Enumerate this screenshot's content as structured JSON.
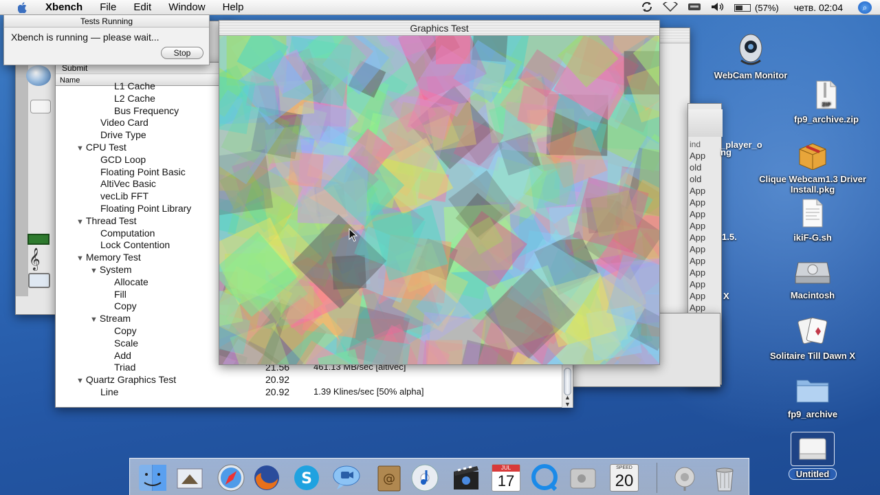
{
  "menubar": {
    "app": "Xbench",
    "items": [
      "File",
      "Edit",
      "Window",
      "Help"
    ],
    "battery": "(57%)",
    "clock": "четв. 02:04"
  },
  "tests_running": {
    "title": "Tests Running",
    "message": "Xbench is running — please wait...",
    "stop_label": "Stop"
  },
  "results": {
    "submit": "Submit",
    "col_name": "Name",
    "rows": [
      {
        "label": "L1 Cache",
        "indent": 4,
        "tri": ""
      },
      {
        "label": "L2 Cache",
        "indent": 4,
        "tri": ""
      },
      {
        "label": "Bus Frequency",
        "indent": 4,
        "tri": ""
      },
      {
        "label": "Video Card",
        "indent": 3,
        "tri": ""
      },
      {
        "label": "Drive Type",
        "indent": 3,
        "tri": ""
      },
      {
        "label": "CPU Test",
        "indent": 2,
        "tri": "▼"
      },
      {
        "label": "GCD Loop",
        "indent": 3,
        "tri": ""
      },
      {
        "label": "Floating Point Basic",
        "indent": 3,
        "tri": ""
      },
      {
        "label": "AltiVec Basic",
        "indent": 3,
        "tri": ""
      },
      {
        "label": "vecLib FFT",
        "indent": 3,
        "tri": ""
      },
      {
        "label": "Floating Point Library",
        "indent": 3,
        "tri": ""
      },
      {
        "label": "Thread Test",
        "indent": 2,
        "tri": "▼"
      },
      {
        "label": "Computation",
        "indent": 3,
        "tri": ""
      },
      {
        "label": "Lock Contention",
        "indent": 3,
        "tri": ""
      },
      {
        "label": "Memory Test",
        "indent": 2,
        "tri": "▼"
      },
      {
        "label": "System",
        "indent": 3,
        "tri": "▼"
      },
      {
        "label": "Allocate",
        "indent": 4,
        "tri": ""
      },
      {
        "label": "Fill",
        "indent": 4,
        "tri": ""
      },
      {
        "label": "Copy",
        "indent": 4,
        "tri": ""
      },
      {
        "label": "Stream",
        "indent": 3,
        "tri": "▼"
      },
      {
        "label": "Copy",
        "indent": 4,
        "tri": ""
      },
      {
        "label": "Scale",
        "indent": 4,
        "tri": ""
      },
      {
        "label": "Add",
        "indent": 4,
        "tri": ""
      },
      {
        "label": "Triad",
        "indent": 4,
        "tri": "",
        "score": "21.56",
        "result": "461.13 MB/sec [altivec]"
      },
      {
        "label": "Quartz Graphics Test",
        "indent": 2,
        "tri": "▼",
        "score": "20.92",
        "result": ""
      },
      {
        "label": "Line",
        "indent": 3,
        "tri": "",
        "score": "20.92",
        "result": "1.39 Klines/sec [50% alpha]"
      }
    ]
  },
  "graphics_test": {
    "title": "Graphics Test"
  },
  "back_window_list": {
    "header": "ind",
    "items": [
      "App",
      "old",
      "old",
      "App",
      "App",
      "App",
      "App",
      "App",
      "App",
      "App",
      "App",
      "App",
      "App",
      "App",
      "App",
      "App",
      "App",
      "App"
    ],
    "fragments": [
      "_player_o",
      "ng",
      "1.5.",
      "X"
    ]
  },
  "desktop_icons": [
    {
      "name": "webcam-monitor",
      "label": "WebCam Monitor"
    },
    {
      "name": "fp9-archive-zip",
      "label": "fp9_archive.zip"
    },
    {
      "name": "clique-webcam-pkg",
      "label": "Clique Webcam1.3 Driver Install.pkg"
    },
    {
      "name": "ikif-g-sh",
      "label": "ikiF-G.sh"
    },
    {
      "name": "macintosh",
      "label": "Macintosh"
    },
    {
      "name": "solitaire",
      "label": "Solitaire Till Dawn X"
    },
    {
      "name": "fp9-archive-folder",
      "label": "fp9_archive"
    },
    {
      "name": "untitled",
      "label": "Untitled"
    }
  ],
  "dock": {
    "apps": [
      "finder",
      "mail",
      "safari",
      "firefox",
      "skype",
      "ichat",
      "address-book",
      "itunes",
      "imovie",
      "ical",
      "quicktime",
      "system-prefs",
      "xbench",
      "network",
      "trash"
    ],
    "ical_month": "JUL",
    "ical_day": "17",
    "xbench_speed": "SPEED",
    "xbench_num": "20"
  },
  "colors": {
    "accent": "#1b5fc4",
    "desktop": "#2f6ab8"
  }
}
